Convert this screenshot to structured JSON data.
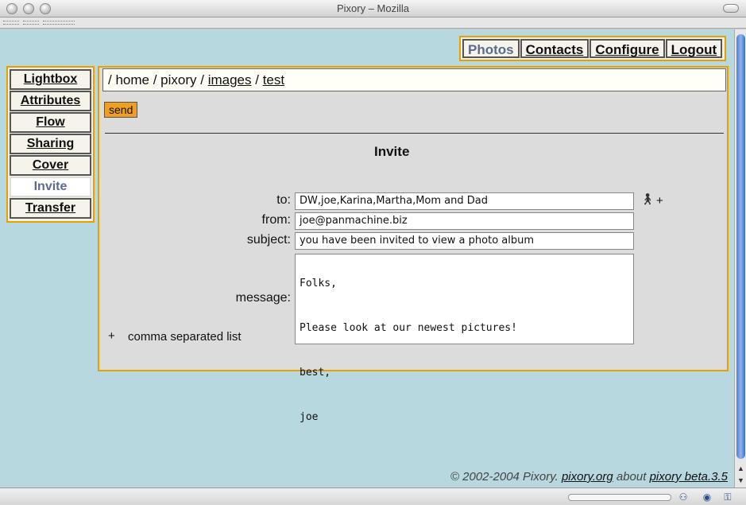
{
  "window": {
    "title": "Pixory – Mozilla"
  },
  "topnav": [
    {
      "label": "Photos",
      "active": true
    },
    {
      "label": "Contacts",
      "active": false
    },
    {
      "label": "Configure",
      "active": false
    },
    {
      "label": "Logout",
      "active": false
    }
  ],
  "sidenav": [
    {
      "label": "Lightbox",
      "active": false
    },
    {
      "label": "Attributes",
      "active": false
    },
    {
      "label": "Flow",
      "active": false
    },
    {
      "label": "Sharing",
      "active": false
    },
    {
      "label": "Cover",
      "active": false
    },
    {
      "label": "Invite",
      "active": true
    },
    {
      "label": "Transfer",
      "active": false
    }
  ],
  "breadcrumb": {
    "root": "/",
    "home": "home",
    "pixory": "pixory",
    "images": "images",
    "test": "test"
  },
  "send_label": "send",
  "invite": {
    "title": "Invite",
    "to_label": "to:",
    "to_value": "DW,joe,Karina,Martha,Mom and Dad",
    "from_label": "from:",
    "from_value": "joe@panmachine.biz",
    "subject_label": "subject:",
    "subject_value": "you have been invited to view a photo album",
    "message_label": "message:",
    "message_lines": [
      "Folks,",
      "Please look at our newest pictures!",
      "best,",
      "joe"
    ],
    "plus": "+",
    "note": "comma separated list"
  },
  "footer": {
    "copyright": "© 2002-2004 Pixory.",
    "site": "pixory.org",
    "about": "about",
    "version": "pixory beta.3.5"
  },
  "icons": {
    "contact": "person-icon",
    "add": "plus-icon"
  }
}
